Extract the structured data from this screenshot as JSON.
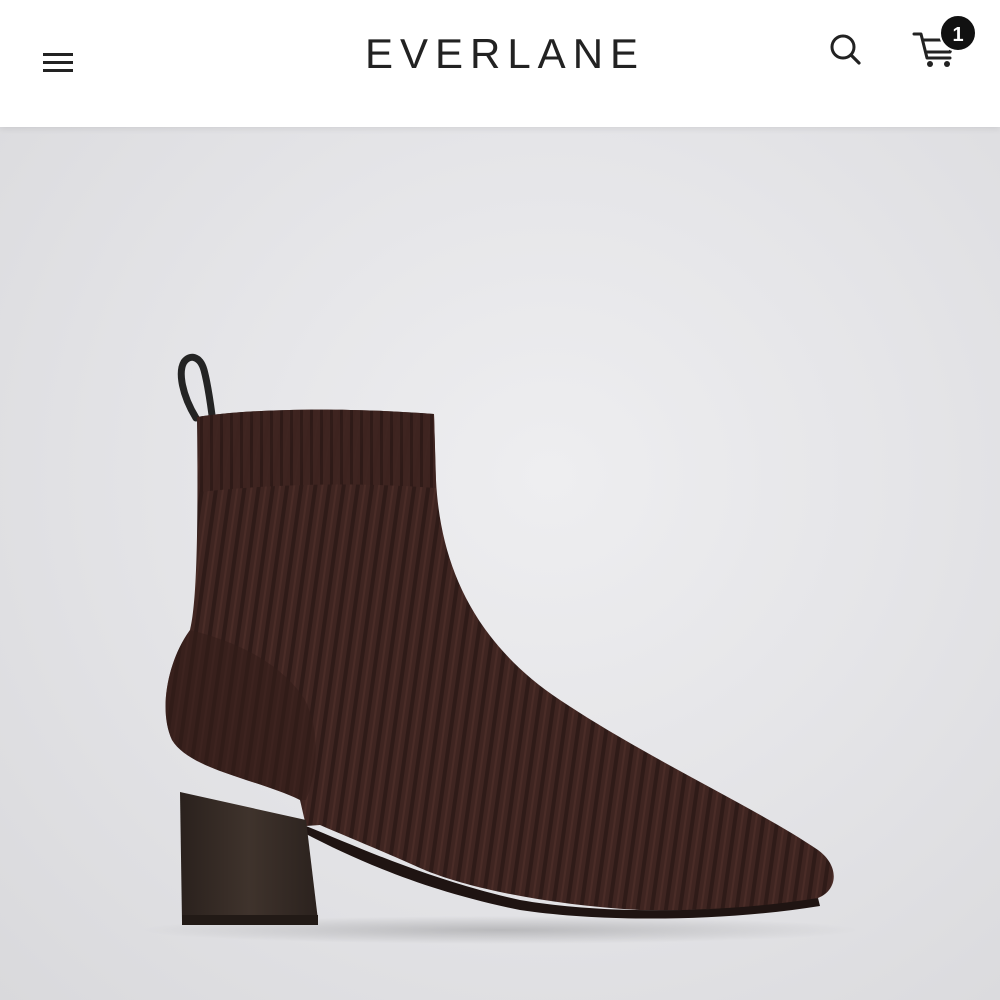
{
  "header": {
    "menu_icon": "hamburger-menu-icon",
    "logo": "EVERLANE",
    "search_icon": "search-icon",
    "cart_icon": "shopping-cart-icon",
    "cart_count": "1"
  },
  "product_image": {
    "subject": "ankle-boot",
    "colors": {
      "knit": "#3f2521",
      "knit_dark": "#2e1a17",
      "heel": "#3a2e28",
      "background": "#e5e5e8"
    }
  }
}
